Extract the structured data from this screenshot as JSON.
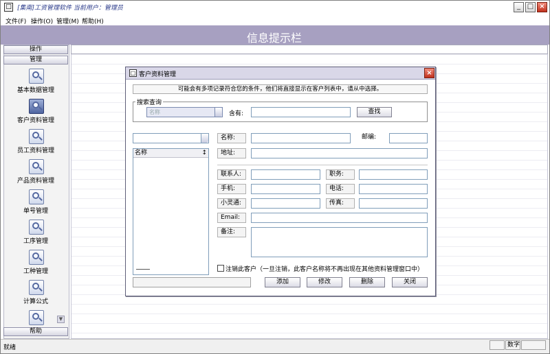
{
  "window": {
    "title": "[集南]工资管理软件  当前用户：管理员",
    "app_icon": "□",
    "minimize": "_",
    "maximize": "□",
    "close": "×"
  },
  "menu": {
    "items": [
      "文件(F)",
      "操作(O)",
      "管理(M)",
      "帮助(H)"
    ]
  },
  "info_banner": "信息提示栏",
  "sidebar": {
    "top_headers": [
      "操作",
      "管理"
    ],
    "bottom_header": "帮助",
    "items": [
      {
        "label": "基本数据管理",
        "icon": "magnifier-icon"
      },
      {
        "label": "客户资料管理",
        "icon": "magnifier-icon",
        "selected": true
      },
      {
        "label": "员工资料管理",
        "icon": "magnifier-icon"
      },
      {
        "label": "产品资料管理",
        "icon": "magnifier-icon"
      },
      {
        "label": "单号管理",
        "icon": "magnifier-icon"
      },
      {
        "label": "工序管理",
        "icon": "magnifier-icon"
      },
      {
        "label": "工种管理",
        "icon": "magnifier-icon"
      },
      {
        "label": "计算公式",
        "icon": "magnifier-icon"
      },
      {
        "label": "",
        "icon": "magnifier-icon"
      }
    ],
    "scroll_down": "▼"
  },
  "status": {
    "left": "就绪",
    "num": "数字"
  },
  "dialog": {
    "title": "客户资料管理",
    "icon": "□",
    "close": "×",
    "notice": "可能会有多项记录符合您的条件，他们将直接显示在客户列表中，请从中选择。",
    "search": {
      "legend": "搜索查询",
      "combo_value": "名称",
      "contains_label": "含有:",
      "contains_value": "",
      "find_button": "查找"
    },
    "list": {
      "combo_value": "",
      "header": "名称",
      "header_sort": "↕"
    },
    "fields": {
      "name_label": "名称:",
      "zip_label": "邮编:",
      "address_label": "地址:",
      "contact_label": "联系人:",
      "title_label": "职务:",
      "mobile_label": "手机:",
      "phone_label": "电话:",
      "pager_label": "小灵通:",
      "fax_label": "传真:",
      "email_label": "Email:",
      "note_label": "备注:"
    },
    "cancel_checkbox_label": "注销此客户（一旦注销，此客户名称将不再出现在其他资料管理窗口中）",
    "buttons": {
      "add": "添加",
      "edit": "修改",
      "delete": "删除",
      "close": "关闭"
    }
  }
}
